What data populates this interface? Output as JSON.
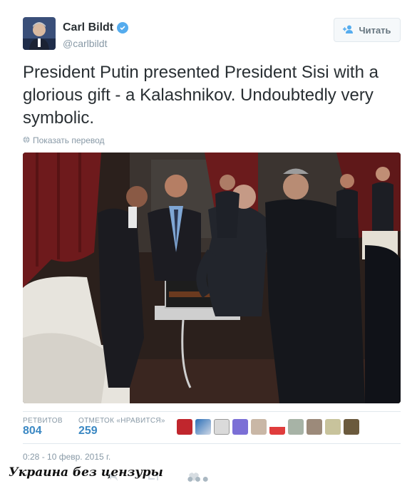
{
  "tweet": {
    "author_name": "Carl Bildt",
    "author_handle": "@carlbildt",
    "follow_label": "Читать",
    "text": "President Putin presented President Sisi with a glorious gift - a Kalashnikov. Undoubtedly very symbolic.",
    "translate_label": "Показать перевод",
    "retweets_label": "РЕТВИТОВ",
    "retweets_count": "804",
    "likes_label": "ОТМЕТОК «НРАВИТСЯ»",
    "likes_count": "259",
    "timestamp": "0:28 - 10 февр. 2015 г."
  },
  "watermark": "Украина без цензуры",
  "colors": {
    "link": "#3b88c3",
    "verified": "#55acee",
    "muted": "#8899a6"
  },
  "icons": {
    "verified": "verified-badge-icon",
    "follow": "add-user-icon",
    "translate": "globe-icon",
    "more": "more-icon"
  }
}
